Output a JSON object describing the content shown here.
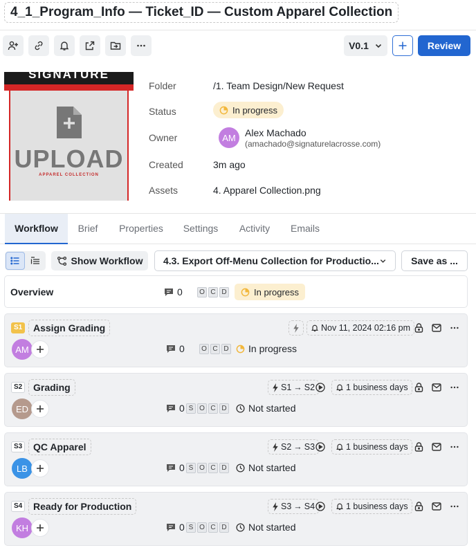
{
  "header": {
    "title": "4_1_Program_Info — Ticket_ID — Custom Apparel Collection"
  },
  "toolbar": {
    "version": "V0.1",
    "review_label": "Review"
  },
  "thumbnail": {
    "brand_text": "SIGNATURE",
    "upload_text": "UPLOAD",
    "sub_text": "APPAREL COLLECTION"
  },
  "meta": {
    "folder_label": "Folder",
    "folder_value": "/1. Team Design/New Request",
    "status_label": "Status",
    "status_value": "In progress",
    "owner_label": "Owner",
    "owner_name": "Alex Machado",
    "owner_email": "(amachado@signaturelacrosse.com)",
    "owner_initials": "AM",
    "created_label": "Created",
    "created_value": "3m ago",
    "assets_label": "Assets",
    "assets_value": "4. Apparel Collection.png"
  },
  "tabs": [
    "Workflow",
    "Brief",
    "Properties",
    "Settings",
    "Activity",
    "Emails"
  ],
  "workflow_bar": {
    "show_workflow": "Show Workflow",
    "selected_workflow": "4.3. Export Off-Menu Collection for Productio...",
    "save_as": "Save as ..."
  },
  "overview": {
    "label": "Overview",
    "comments": "0",
    "letters": [
      "O",
      "C",
      "D"
    ],
    "status": "In progress"
  },
  "stages": [
    {
      "tag": "S1",
      "name": "Assign Grading",
      "due": "Nov 11, 2024 02:16 pm",
      "initials": "AM",
      "avatar_color": "#c27ee0",
      "comments": "0",
      "letters": [
        "O",
        "C",
        "D"
      ],
      "status": "In progress"
    },
    {
      "tag": "S2",
      "name": "Grading",
      "from": "S1",
      "to": "S2",
      "due": "1 business days",
      "initials": "ED",
      "avatar_color": "#b59a8d",
      "comments": "0",
      "letters": [
        "S",
        "O",
        "C",
        "D"
      ],
      "status": "Not started"
    },
    {
      "tag": "S3",
      "name": "QC Apparel",
      "from": "S2",
      "to": "S3",
      "due": "1 business days",
      "initials": "LB",
      "avatar_color": "#3b93e6",
      "comments": "0",
      "letters": [
        "S",
        "O",
        "C",
        "D"
      ],
      "status": "Not started"
    },
    {
      "tag": "S4",
      "name": "Ready for Production",
      "from": "S3",
      "to": "S4",
      "due": "1 business days",
      "initials": "KH",
      "avatar_color": "#c27ee0",
      "comments": "0",
      "letters": [
        "S",
        "O",
        "C",
        "D"
      ],
      "status": "Not started"
    }
  ],
  "colors": {
    "accent": "#2266d0",
    "progress": "#f2b73b",
    "stage_bg": "#f0f1f3"
  },
  "icons": [
    "add-user-icon",
    "link-icon",
    "bell-icon",
    "share-icon",
    "move-folder-icon",
    "more-icon",
    "chevron-down-icon",
    "plus-icon",
    "list-view-icon",
    "detail-view-icon",
    "workflow-icon",
    "comment-icon",
    "progress-icon",
    "clock-icon",
    "lightning-icon",
    "play-icon",
    "lock-icon",
    "mail-icon"
  ]
}
